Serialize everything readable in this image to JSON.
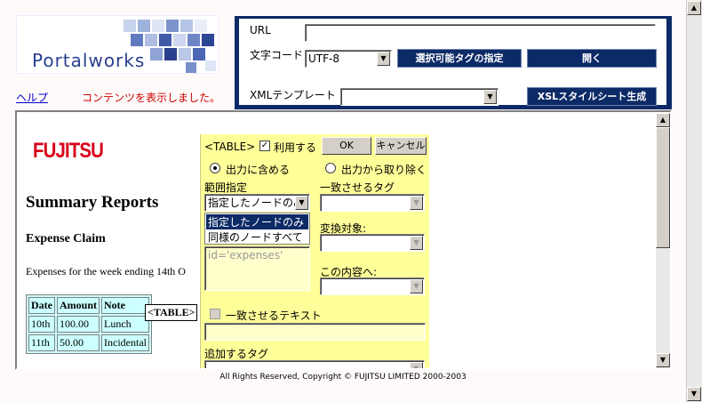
{
  "header": {
    "logo_text": "Portalworks",
    "help_link": "ヘルプ",
    "status_message": "コンテンツを表示しました。"
  },
  "controls": {
    "url_label": "URL",
    "url_value": "",
    "charset_label": "文字コード",
    "charset_value": "UTF-8",
    "select_tags_button": "選択可能タグの指定",
    "open_button": "開く",
    "xml_template_label": "XMLテンプレート",
    "xml_template_value": "",
    "xsl_button": "XSLスタイルシート生成"
  },
  "content": {
    "brand": "FUJITSU",
    "title": "Summary Reports",
    "subtitle": "Expense Claim",
    "paragraph": "Expenses for the week ending 14th O",
    "table_headers": [
      "Date",
      "Amount",
      "Note"
    ],
    "table_rows": [
      [
        "10th",
        "100.00",
        "Lunch"
      ],
      [
        "11th",
        "50.00",
        "Incidental"
      ]
    ],
    "table_tag": "<TABLE>"
  },
  "panel": {
    "tag_label": "<TABLE>",
    "use_checkbox_label": "利用する",
    "ok_button": "OK",
    "cancel_button": "キャンセル",
    "include_radio": "出力に含める",
    "exclude_radio": "出力から取り除く",
    "range_label": "範囲指定",
    "range_value": "指定したノードのみ",
    "range_options": [
      "指定したノードのみ",
      "同様のノードすべて"
    ],
    "match_tag_label": "一致させるタグ",
    "transform_label": "変換対象:",
    "to_content_label": "この内容へ:",
    "attribute_text": "id='expenses'",
    "match_text_label": "一致させるテキスト",
    "add_tag_label": "追加するタグ"
  },
  "footer": {
    "copyright": "All Rights Reserved, Copyright © FUJITSU LIMITED 2000-2003"
  },
  "colors": {
    "navy": "#0c2a66",
    "panel_yellow": "#ffff99",
    "table_cyan": "#ccffff",
    "brand_red": "#d8001a",
    "status_red": "#cc0000"
  }
}
